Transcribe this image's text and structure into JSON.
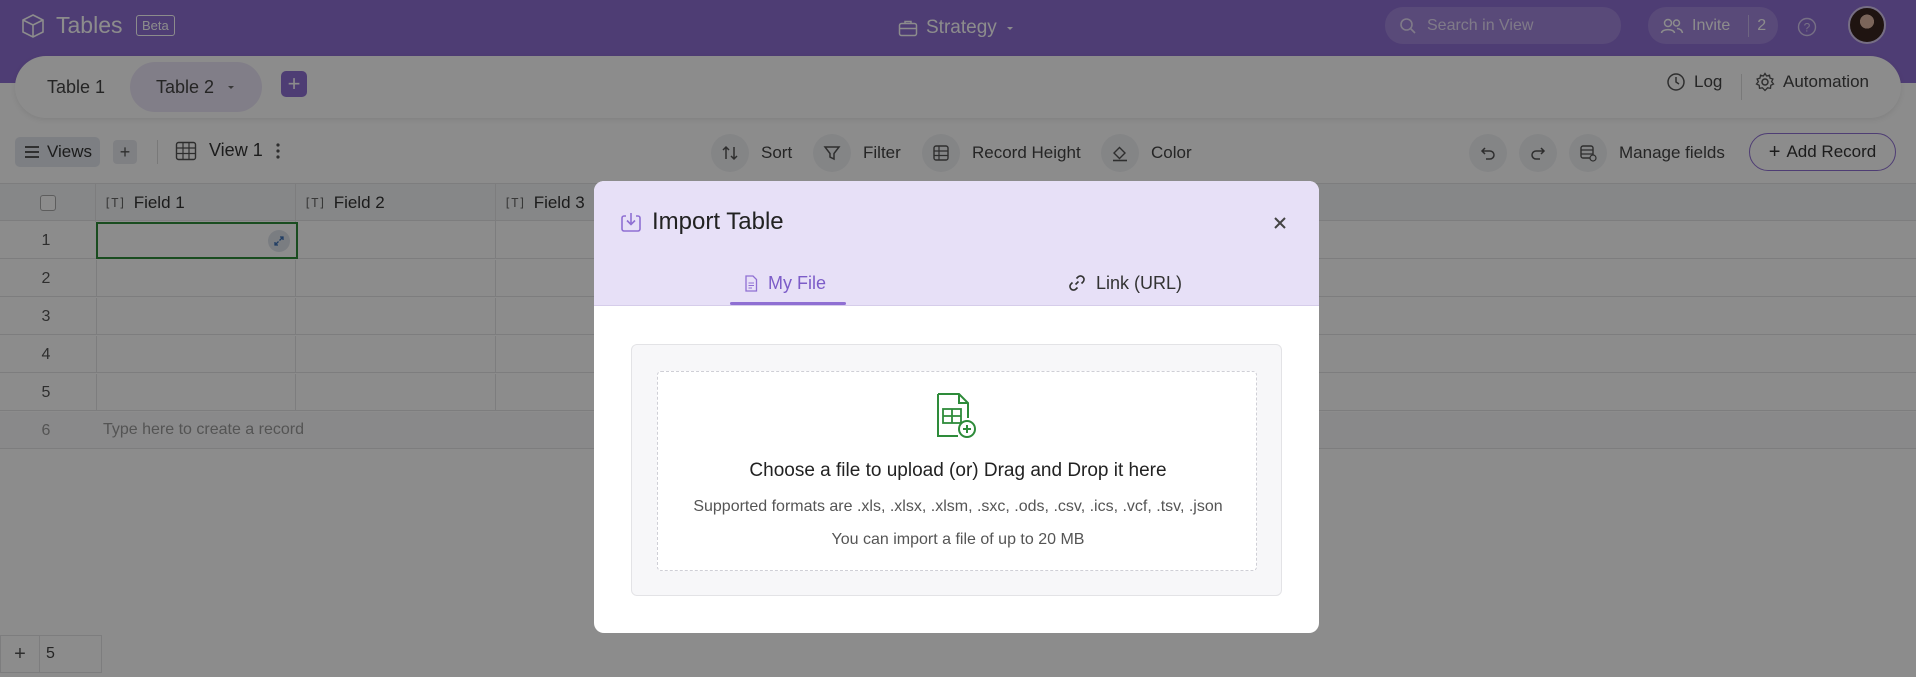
{
  "header": {
    "app_title": "Tables",
    "beta_label": "Beta",
    "workspace": "Strategy",
    "search_placeholder": "Search in View",
    "invite_label": "Invite",
    "invite_count": "2"
  },
  "tabs": {
    "items": [
      {
        "label": "Table 1"
      },
      {
        "label": "Table 2"
      }
    ],
    "log_label": "Log",
    "automation_label": "Automation"
  },
  "toolbar": {
    "views_label": "Views",
    "view_name": "View 1",
    "sort_label": "Sort",
    "filter_label": "Filter",
    "record_height_label": "Record Height",
    "color_label": "Color",
    "manage_fields_label": "Manage fields",
    "add_record_label": "Add Record"
  },
  "grid": {
    "columns": [
      "Field 1",
      "Field 2",
      "Field 3"
    ],
    "row_numbers": [
      "1",
      "2",
      "3",
      "4",
      "5",
      "6"
    ],
    "new_record_hint": "Type here to create a record",
    "record_count": "5"
  },
  "modal": {
    "title": "Import Table",
    "tab_file": "My File",
    "tab_url": "Link (URL)",
    "drop_main": "Choose a file to upload (or) Drag and Drop it here",
    "drop_formats": "Supported formats are .xls, .xlsx, .xlsm, .sxc, .ods, .csv, .ics, .vcf, .tsv, .json",
    "drop_limit": "You can import a file of up to 20 MB"
  },
  "colors": {
    "brand": "#8f6fd3",
    "modal_header": "#e7e0f7",
    "active_cell": "#2e8b3a"
  }
}
